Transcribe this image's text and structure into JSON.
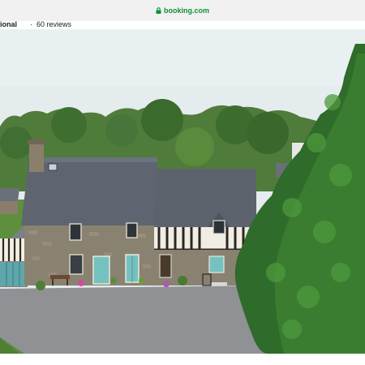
{
  "browser": {
    "url": "booking.com"
  },
  "listing": {
    "name_fragment": "ional",
    "separator": "·",
    "reviews": "60 reviews"
  },
  "photo": {
    "subject": "stone-cottage-with-timber-framed-annex",
    "colors": {
      "sky": "#e4ecee",
      "stone": "#8a8270",
      "roof": "#5f6570",
      "door": "#74c2c0",
      "tree": "#2f6b2a",
      "gravel": "#8f9195"
    }
  }
}
